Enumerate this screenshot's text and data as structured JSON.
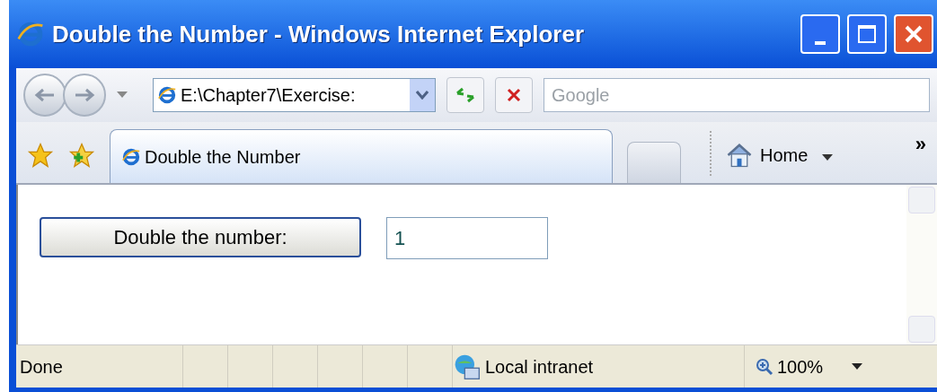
{
  "window": {
    "title": "Double the Number - Windows Internet Explorer"
  },
  "address_bar": {
    "value": "E:\\Chapter7\\Exercise:"
  },
  "search": {
    "placeholder": "Google"
  },
  "tabs": [
    {
      "label": "Double the Number",
      "selected": true
    }
  ],
  "command_bar": {
    "home": "Home",
    "chevron": "»"
  },
  "page": {
    "button": "Double the number:",
    "field_value": "1"
  },
  "status_bar": {
    "status": "Done",
    "zone": "Local intranet",
    "zoom": "100%"
  }
}
